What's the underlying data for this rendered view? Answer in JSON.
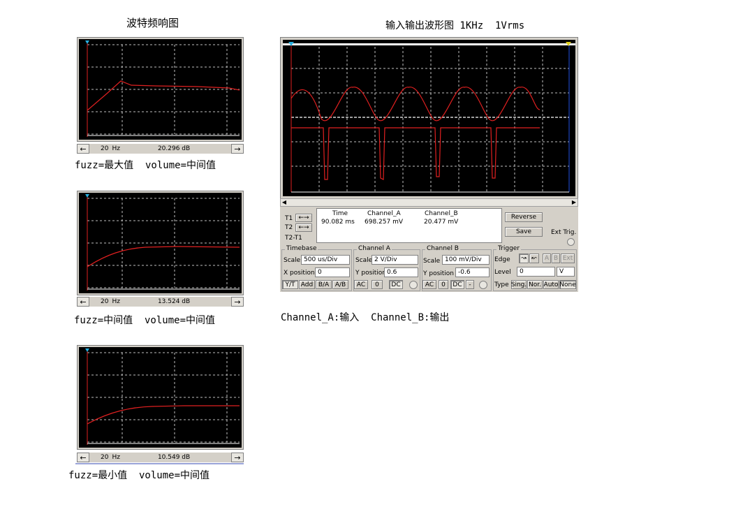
{
  "titles": {
    "bode": "波特频响图",
    "waveform": "输入输出波形图 1KHz  1Vrms"
  },
  "bode": [
    {
      "freq": "20",
      "freq_unit": "Hz",
      "gain": "20.296 dB",
      "caption": "fuzz=最大值  volume=中间值"
    },
    {
      "freq": "20",
      "freq_unit": "Hz",
      "gain": "13.524 dB",
      "caption": "fuzz=中间值  volume=中间值"
    },
    {
      "freq": "20",
      "freq_unit": "Hz",
      "gain": "10.549 dB",
      "caption": "fuzz=最小值  volume=中间值"
    }
  ],
  "scope": {
    "t1": "T1",
    "t2": "T2",
    "t2t1": "T2-T1",
    "readout": {
      "time_h": "Time",
      "cha_h": "Channel_A",
      "chb_h": "Channel_B",
      "time": "90.082 ms",
      "cha": "698.257 mV",
      "chb": "20.477 mV"
    },
    "reverse": "Reverse",
    "save": "Save",
    "ext_trig": "Ext Trig.",
    "timebase": {
      "title": "Timebase",
      "scale_lbl": "Scale",
      "scale": "500 us/Div",
      "xpos_lbl": "X position",
      "xpos": "0",
      "modes": [
        "Y/T",
        "Add",
        "B/A",
        "A/B"
      ]
    },
    "cha": {
      "title": "Channel A",
      "scale_lbl": "Scale",
      "scale": "2  V/Div",
      "ypos_lbl": "Y position",
      "ypos": "0.6",
      "coupling": [
        "AC",
        "0",
        "DC"
      ]
    },
    "chb": {
      "title": "Channel B",
      "scale_lbl": "Scale",
      "scale": "100 mV/Div",
      "ypos_lbl": "Y position",
      "ypos": "-0.6",
      "coupling": [
        "AC",
        "0",
        "DC",
        "-"
      ]
    },
    "trigger": {
      "title": "Trigger",
      "edge_lbl": "Edge",
      "level_lbl": "Level",
      "level": "0",
      "level_unit": "V",
      "sources": [
        "A",
        "B",
        "Ext"
      ],
      "type_lbl": "Type",
      "types": [
        "Sing.",
        "Nor.",
        "Auto",
        "None"
      ]
    }
  },
  "caption_channels": "Channel_A:输入  Channel_B:输出",
  "colors": {
    "trace": "#e02020",
    "grid": "#c0c0c0",
    "screen": "#000000",
    "panel": "#d4d0c8"
  }
}
